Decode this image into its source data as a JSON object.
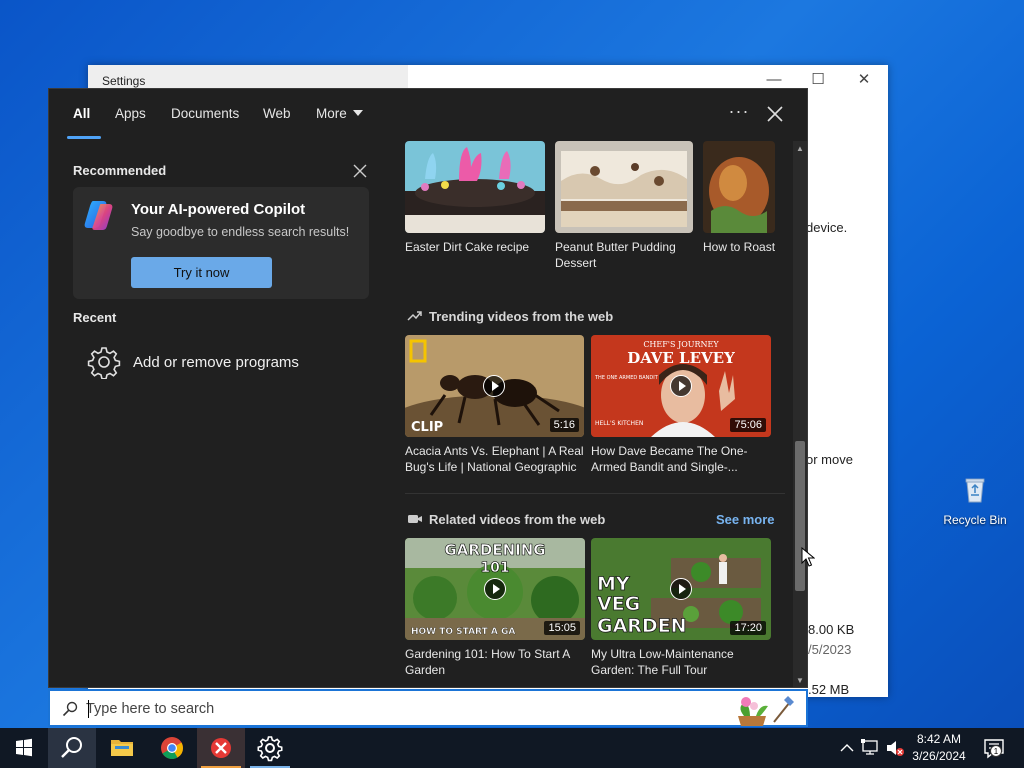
{
  "settings_window": {
    "title": "Settings",
    "text_device": "device.",
    "text_move": "or move",
    "text_size1": "8.00 KB",
    "text_date": "/5/2023",
    "text_size2": ".52 MB"
  },
  "desktop": {
    "recycle_bin": "Recycle Bin"
  },
  "search_panel": {
    "tabs": [
      {
        "label": "All",
        "active": true
      },
      {
        "label": "Apps"
      },
      {
        "label": "Documents"
      },
      {
        "label": "Web"
      },
      {
        "label": "More"
      }
    ],
    "recommended_label": "Recommended",
    "copilot": {
      "title": "Your AI-powered Copilot",
      "subtitle": "Say goodbye to endless search results!",
      "button": "Try it now"
    },
    "recent_label": "Recent",
    "recent_items": [
      {
        "label": "Add or remove programs",
        "icon": "gear-icon"
      }
    ],
    "recipes": [
      {
        "title": "Easter Dirt Cake recipe"
      },
      {
        "title": "Peanut Butter Pudding Dessert"
      },
      {
        "title": "How to Roast"
      }
    ],
    "trending": {
      "heading": "Trending videos from the web",
      "videos": [
        {
          "title": "Acacia Ants Vs. Elephant | A Real Bug's Life | National Geographic",
          "duration": "5:16",
          "overlay": "CLIP"
        },
        {
          "title": "How Dave Became The One-Armed Bandit and Single-...",
          "duration": "75:06",
          "overlay_top": "CHEF'S JOURNEY",
          "overlay_name": "DAVE LEVEY",
          "overlay_small": "THE ONE ARMED BANDIT",
          "overlay_bottom": "HELL'S KITCHEN"
        }
      ]
    },
    "related": {
      "heading": "Related videos from the web",
      "see_more": "See more",
      "videos": [
        {
          "title": "Gardening 101: How To Start A Garden",
          "duration": "15:05",
          "overlay_top": "GARDENING",
          "overlay_num": "101",
          "overlay_bottom": "HOW TO START A GA"
        },
        {
          "title": "My Ultra Low-Maintenance Garden: The Full Tour",
          "duration": "17:20",
          "overlay_line1": "MY",
          "overlay_line2": "VEG",
          "overlay_line3": "GARDEN"
        }
      ]
    },
    "search_placeholder": "Type here to search"
  },
  "taskbar": {
    "time": "8:42 AM",
    "date": "3/26/2024",
    "notification_count": "1"
  },
  "colors": {
    "accent": "#4fa3f7",
    "panel_bg": "#202020",
    "taskbar_bg": "#101824"
  }
}
